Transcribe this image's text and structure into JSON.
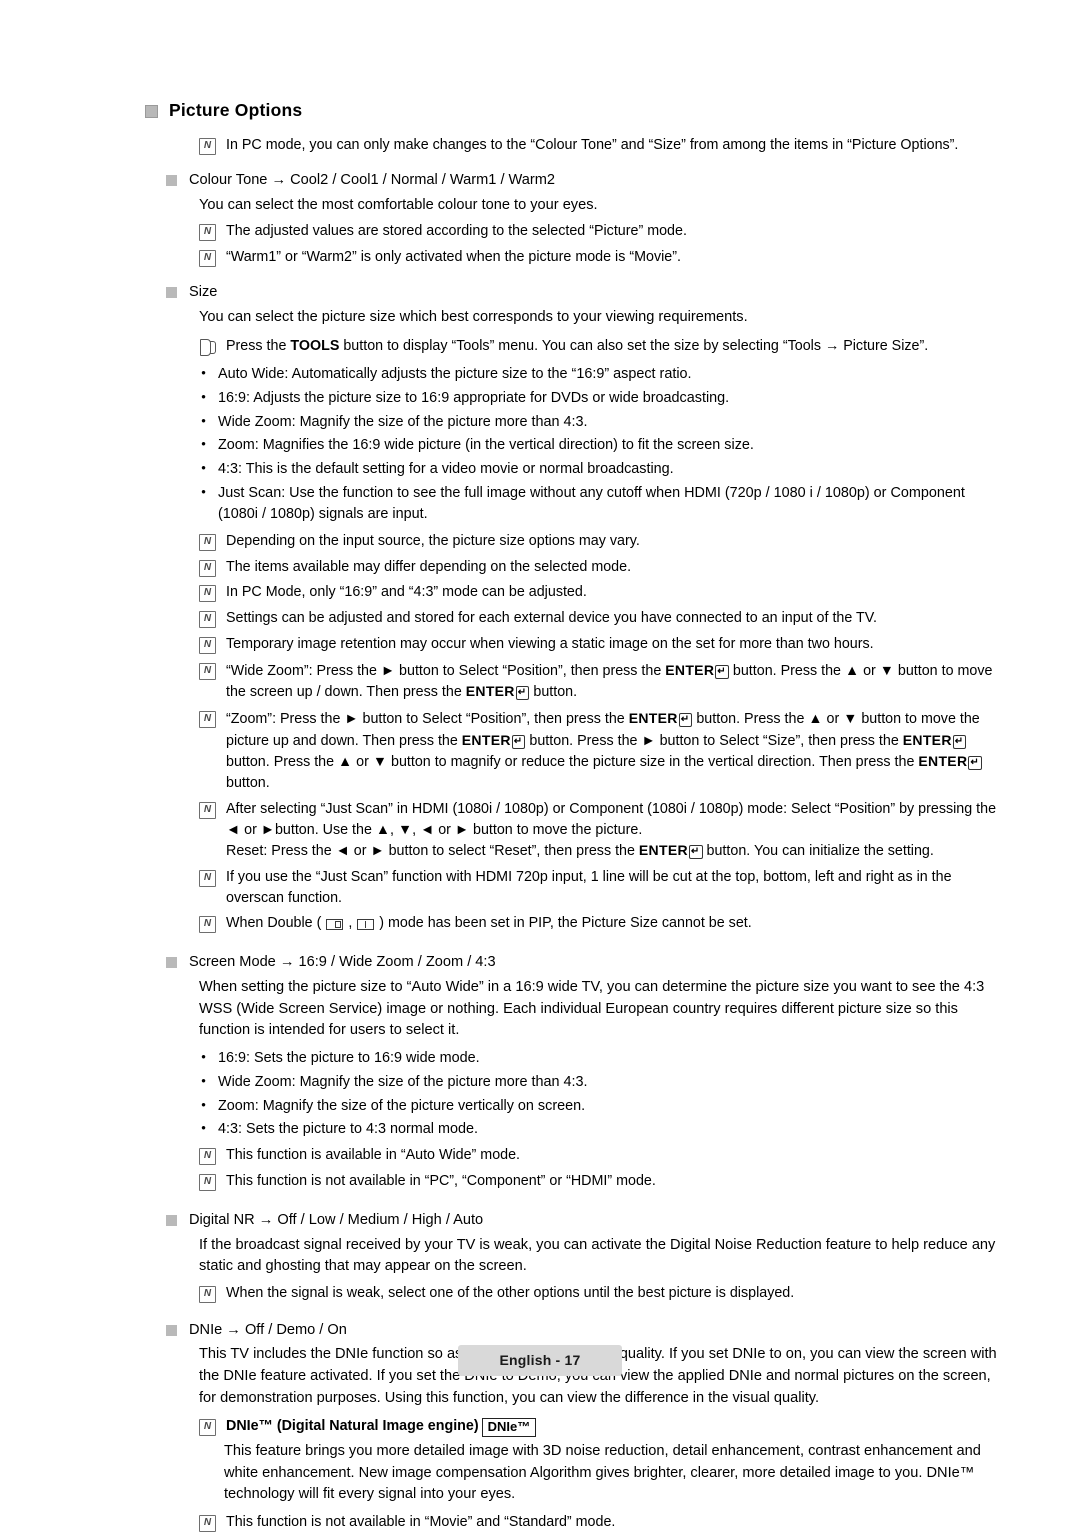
{
  "heading": "Picture Options",
  "intro_note": "In PC mode, you can only make changes to the “Colour Tone” and “Size” from among the items in “Picture Options”.",
  "sections": [
    {
      "title": "Colour Tone  →  Cool2 / Cool1 / Normal / Warm1 / Warm2",
      "body": "You can select the most comfortable colour tone to your eyes.",
      "notes": [
        "The adjusted values are stored according to the selected “Picture” mode.",
        "“Warm1” or “Warm2” is only activated when the picture mode is “Movie”."
      ]
    },
    {
      "title": "Size",
      "body": "You can select the picture size which best corresponds to your viewing requirements.",
      "tools_note_pre": "Press the ",
      "tools_note_bold": "TOOLS",
      "tools_note_post": " button to display “Tools” menu. You can also set the size by selecting “Tools → Picture Size”.",
      "bullets": [
        "Auto Wide: Automatically adjusts the picture size to the “16:9” aspect ratio.",
        "16:9: Adjusts the picture size to 16:9 appropriate for DVDs or wide broadcasting.",
        "Wide Zoom: Magnify the size of the picture more than 4:3.",
        "Zoom: Magnifies the 16:9 wide picture (in the vertical direction) to fit the screen size.",
        "4:3: This is the default setting for a video movie or normal broadcasting.",
        "Just Scan: Use the function to see the full image without any cutoff when HDMI (720p / 1080 i / 1080p) or Component (1080i / 1080p) signals are input."
      ],
      "notes": [
        "Depending on the input source, the picture size options may vary.",
        "The items available may differ depending on the selected mode.",
        "In PC Mode, only “16:9” and “4:3” mode can be adjusted.",
        "Settings can be adjusted and stored for each external device you have connected to an input of the TV.",
        "Temporary image retention may occur when viewing a static image on the set for more than two hours."
      ],
      "wide_zoom_note": {
        "p1": "“Wide Zoom”: Press the ► button to Select “Position”, then press the ",
        "enter1": "ENTER",
        "p2": " button. Press the ▲ or ▼ button to move the screen up / down. Then press the ",
        "enter2": "ENTER",
        "p3": " button."
      },
      "zoom_note": {
        "p1": "“Zoom”: Press the ► button to Select “Position”, then press the ",
        "enter1": "ENTER",
        "p2": " button. Press the ▲ or ▼ button to move the picture up and down. Then press the ",
        "enter2": "ENTER",
        "p3": " button. Press the ► button to Select “Size”, then press the ",
        "enter3": "ENTER",
        "p4": " button. Press the ▲ or ▼ button to magnify or reduce the picture size in the vertical direction. Then press the ",
        "enter4": "ENTER",
        "p5": " button."
      },
      "just_scan_note": {
        "p1": "After selecting “Just Scan” in HDMI (1080i / 1080p) or Component (1080i / 1080p) mode: Select “Position” by pressing the ◄ or ►button. Use the ▲, ▼, ◄ or ► button to move the picture.",
        "p2": "Reset: Press the ◄ or ► button to select “Reset”, then press the ",
        "enter1": "ENTER",
        "p3": " button. You can initialize the setting."
      },
      "notes2": [
        "If you use the “Just Scan” function with HDMI 720p input, 1 line will be cut at the top, bottom, left and right as in the overscan function."
      ],
      "double_note": {
        "p1": "When Double ( ",
        "p2": " , ",
        "p3": " ) mode has been set in PIP, the Picture Size cannot be set."
      }
    },
    {
      "title": "Screen Mode  →  16:9 / Wide Zoom / Zoom / 4:3",
      "body": "When setting the picture size to “Auto Wide” in a 16:9 wide TV, you can determine the picture size you want to see the 4:3 WSS (Wide Screen Service) image or nothing. Each individual European country requires different picture size so this function is intended for users to select it.",
      "bullets": [
        "16:9: Sets the picture to 16:9 wide mode.",
        "Wide Zoom: Magnify the size of the picture more than 4:3.",
        "Zoom: Magnify the size of the picture vertically on screen.",
        "4:3: Sets the picture to 4:3 normal mode."
      ],
      "notes": [
        "This function is available in “Auto Wide” mode.",
        "This function is not available in “PC”, “Component” or “HDMI” mode."
      ]
    },
    {
      "title": "Digital NR  →  Off / Low / Medium / High / Auto",
      "body": "If the broadcast signal received by your TV is weak, you can activate the Digital Noise Reduction feature to help reduce any static and ghosting that may appear on the screen.",
      "notes": [
        "When the signal is weak, select one of the other options until the best picture is displayed."
      ]
    },
    {
      "title": "DNIe  →  Off / Demo / On",
      "body": "This TV includes the DNIe function so as to provide a high visual quality. If you set DNIe to on, you can view the screen with the DNIe feature activated. If you set the DNIe to Demo, you can view the applied DNIe and normal pictures on the screen, for demonstration purposes. Using this function, you can view the difference in the visual quality.",
      "dnie_note": {
        "label": "DNIe™ (Digital Natural Image engine)",
        "badge": "DNIe™"
      },
      "dnie_body": "This feature brings you more detailed image with 3D noise reduction, detail enhancement, contrast enhancement and white enhancement. New image compensation Algorithm gives brighter, clearer, more detailed image to you. DNIe™ technology will fit every signal into your eyes.",
      "notes2": [
        "This function is not available in “Movie” and “Standard” mode."
      ]
    }
  ],
  "footer": "English - 17"
}
